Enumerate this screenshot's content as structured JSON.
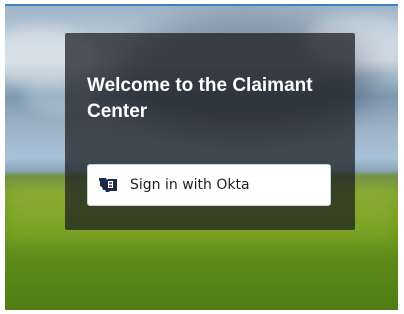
{
  "login_card": {
    "welcome_text": "Welcome to the Claimant Center",
    "signin_button_label": "Sign in with Okta",
    "signin_icon": "montana-state-seal-icon"
  },
  "colors": {
    "top_accent": "#3f82c4",
    "card_background": "rgba(25,28,30,0.72)",
    "welcome_text": "#ffffff",
    "button_background": "#ffffff",
    "button_text": "#1f1f1f"
  }
}
